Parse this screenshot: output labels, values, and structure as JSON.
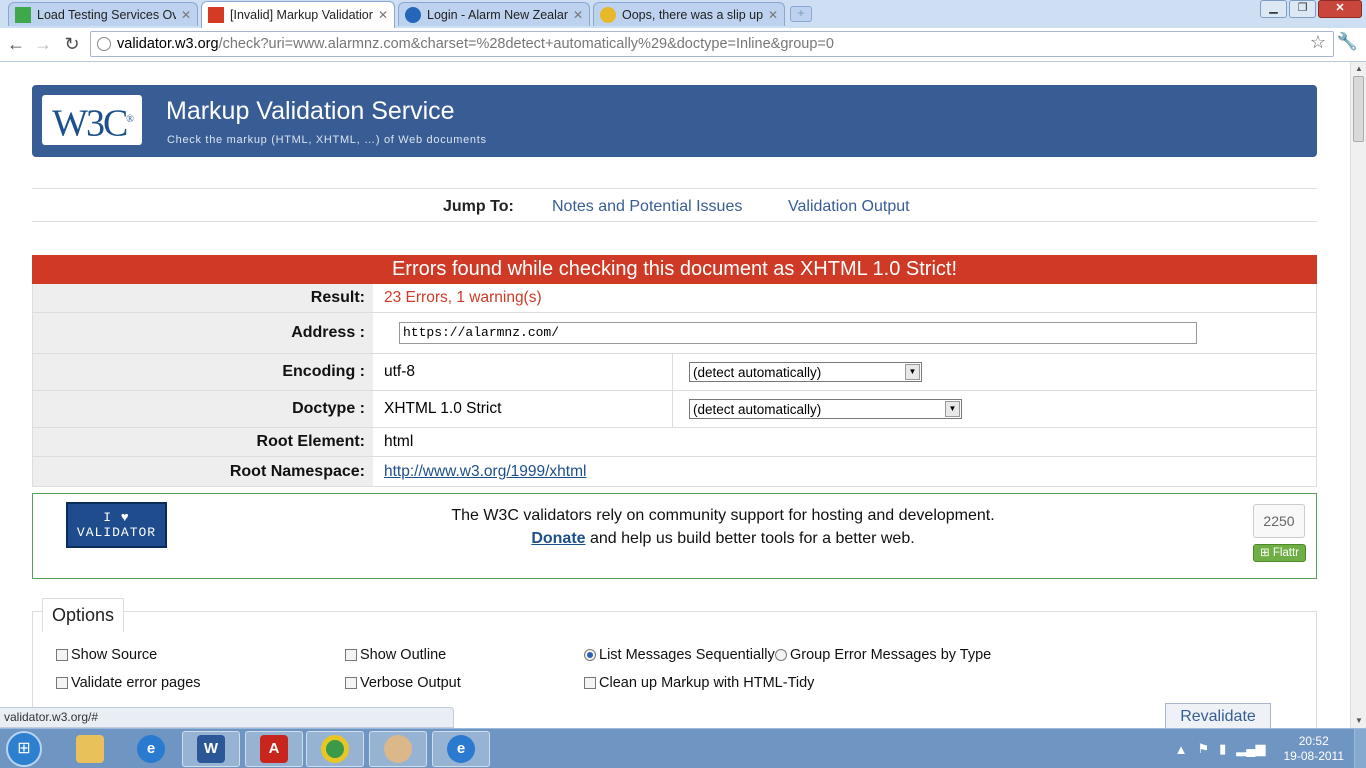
{
  "browser": {
    "tabs": [
      {
        "title": "Load Testing Services Overv",
        "active": false,
        "color": "#3ea84b"
      },
      {
        "title": "[Invalid] Markup Validation",
        "active": true,
        "color": "#d33b25"
      },
      {
        "title": "Login - Alarm New Zealand",
        "active": false,
        "color": "#2566b8"
      },
      {
        "title": "Oops, there was a slip up! -",
        "active": false,
        "color": "#e7b928"
      }
    ],
    "url_host": "validator.w3.org",
    "url_rest": "/check?uri=www.alarmnz.com&charset=%28detect+automatically%29&doctype=Inline&group=0"
  },
  "banner": {
    "logo_text": "W3C",
    "logo_sup": "®",
    "title": "Markup Validation Service",
    "tagline": "Check the markup (HTML, XHTML, …) of Web documents"
  },
  "jump": {
    "label": "Jump To:",
    "links": [
      "Notes and Potential Issues",
      "Validation Output"
    ]
  },
  "error_banner": "Errors found while checking this document as XHTML 1.0 Strict!",
  "results": {
    "result_label": "Result:",
    "result_value": "23 Errors, 1 warning(s)",
    "address_label": "Address :",
    "address_value": "https://alarmnz.com/",
    "encoding_label": "Encoding :",
    "encoding_value": "utf-8",
    "encoding_select": "(detect automatically)",
    "doctype_label": "Doctype :",
    "doctype_value": "XHTML 1.0 Strict",
    "doctype_select": "(detect automatically)",
    "root_label": "Root Element:",
    "root_value": "html",
    "ns_label": "Root Namespace:",
    "ns_value": "http://www.w3.org/1999/xhtml"
  },
  "donate": {
    "badge_line1": "I ♥",
    "badge_line2": "VALIDATOR",
    "text1": "The W3C validators rely on community support for hosting and development.",
    "link": "Donate",
    "text2": " and help us build better tools for a better web.",
    "flattr_count": "2250",
    "flattr_label": "Flattr"
  },
  "options": {
    "legend": "Options",
    "show_source": "Show Source",
    "show_outline": "Show Outline",
    "list_sequential": "List Messages Sequentially",
    "group_errors": "Group Error Messages by Type",
    "validate_error_pages": "Validate error pages",
    "verbose_output": "Verbose Output",
    "cleanup_tidy": "Clean up Markup with HTML-Tidy",
    "revalidate": "Revalidate"
  },
  "status_url": "validator.w3.org/#",
  "taskbar": {
    "time": "20:52",
    "date": "19-08-2011"
  }
}
